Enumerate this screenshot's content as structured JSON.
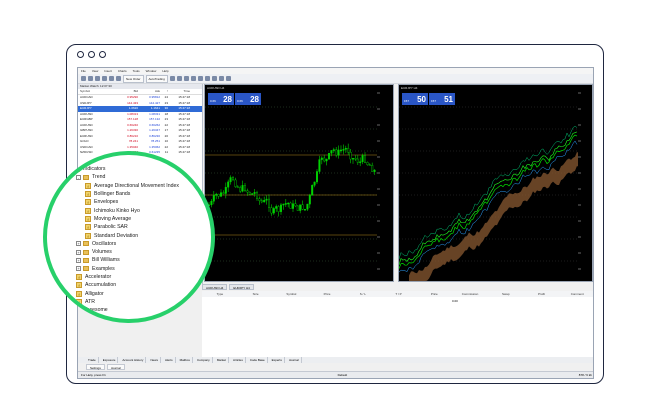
{
  "menu": [
    "File",
    "View",
    "Insert",
    "Charts",
    "Tools",
    "Window",
    "Help"
  ],
  "toolbar": {
    "new_order": "New Order",
    "autotrading": "AutoTrading"
  },
  "market_watch": {
    "title": "Market Watch: 12:07:30",
    "columns": [
      "Symbol",
      "Bid",
      "Ask",
      "!",
      "Time"
    ],
    "rows": [
      {
        "symbol": "AUDCAD",
        "bid": "0.95290",
        "ask": "0.95812",
        "spread": "24",
        "time": "15:47:18"
      },
      {
        "symbol": "USDJPY",
        "bid": "144.433",
        "ask": "144.427",
        "spread": "23",
        "time": "15:47:18"
      },
      {
        "symbol": "EURJPY",
        "bid": "1.0620",
        "ask": "1.1641",
        "spread": "30",
        "time": "15:47:18"
      },
      {
        "symbol": "AUDUSD",
        "bid": "1.08313",
        "ask": "1.08331",
        "spread": "18",
        "time": "15:47:18"
      },
      {
        "symbol": "EURGBP",
        "bid": "157.128",
        "ask": "157.132",
        "spread": "23",
        "time": "15:47:18"
      },
      {
        "symbol": "AUDUSD",
        "bid": "0.66240",
        "ask": "0.66262",
        "spread": "22",
        "time": "15:47:18"
      },
      {
        "symbol": "GBPUSD",
        "bid": "1.26330",
        "ask": "1.26347",
        "spread": "17",
        "time": "15:47:18"
      },
      {
        "symbol": "EURUSD",
        "bid": "0.86210",
        "ask": "0.86230",
        "spread": "20",
        "time": "15:47:18"
      },
      {
        "symbol": "GOLD",
        "bid": "78.241",
        "ask": "78.251",
        "spread": "10",
        "time": "15:47:18"
      },
      {
        "symbol": "USDCAD",
        "bid": "1.35040",
        "ask": "1.35062",
        "spread": "22",
        "time": "15:47:18"
      },
      {
        "symbol": "NZDUSD",
        "bid": "0.61224",
        "ask": "0.61235",
        "spread": "11",
        "time": "15:47:18"
      }
    ]
  },
  "chart_left": {
    "title": "AUDUSD H4",
    "sell_label": "SELL",
    "sell_price": "0.66",
    "sell_big": "28",
    "sell_sup": "4",
    "buy_label": "BUY",
    "buy_price": "0.66",
    "buy_big": "28",
    "buy_sup": "8",
    "bull_color": "#00d200",
    "bear_color": "#00d200",
    "bg": "#000000",
    "x_labels": [
      "9 Nov 2022",
      "22 Nov 2022",
      "5 Dec 2022",
      "18 Dec 2022",
      "1 Jan 2023",
      "12 Jan 2023",
      "25 Jan 2023",
      "7 Feb 2023",
      "20 Feb 2023",
      "5 Mar 2023"
    ]
  },
  "chart_right": {
    "title": "EURJPY H4",
    "sell_label": "SELL",
    "sell_price": "157",
    "sell_big": "50",
    "sell_sup": "0",
    "buy_label": "BUY",
    "buy_price": "157",
    "buy_big": "51",
    "buy_sup": "3",
    "x_labels": [
      "1 Jun 2023",
      "8 Jun 2023",
      "14 Jun 2023",
      "20 Jun 2023",
      "26 Jun 2023",
      "2 Jul 2023"
    ]
  },
  "chart_tabs": [
    "AUDUSD H4",
    "EURJPY H4"
  ],
  "terminal": {
    "columns": [
      "Type",
      "Size",
      "Symbol",
      "Price",
      "S / L",
      "T / P",
      "Price",
      "Commission",
      "Swap",
      "Profit",
      "Comment"
    ],
    "profit": "0.00"
  },
  "bottom_tabs": [
    "Trade",
    "Exposure",
    "Account History",
    "News",
    "Alerts",
    "Mailbox",
    "Company",
    "Market",
    "Articles",
    "Code Base",
    "Experts",
    "Journal"
  ],
  "sub_tabs": [
    "Settings",
    "Journal"
  ],
  "status": {
    "left": "For Help, press F1",
    "middle": "Default",
    "right": "878 / 6 kb"
  },
  "navigator": {
    "items": [
      {
        "label": "Indicators",
        "indent": 0,
        "kind": "folder",
        "pm": "-"
      },
      {
        "label": "Trend",
        "indent": 1,
        "kind": "folder",
        "pm": "-"
      },
      {
        "label": "Average Directional Movement Index",
        "indent": 2,
        "kind": "indicator"
      },
      {
        "label": "Bollinger Bands",
        "indent": 2,
        "kind": "indicator"
      },
      {
        "label": "Envelopes",
        "indent": 2,
        "kind": "indicator"
      },
      {
        "label": "Ichimoku Kinko Hyo",
        "indent": 2,
        "kind": "indicator"
      },
      {
        "label": "Moving Average",
        "indent": 2,
        "kind": "indicator"
      },
      {
        "label": "Parabolic SAR",
        "indent": 2,
        "kind": "indicator"
      },
      {
        "label": "Standard Deviation",
        "indent": 2,
        "kind": "indicator"
      },
      {
        "label": "Oscillators",
        "indent": 1,
        "kind": "folder",
        "pm": "+"
      },
      {
        "label": "Volumes",
        "indent": 1,
        "kind": "folder",
        "pm": "+"
      },
      {
        "label": "Bill Williams",
        "indent": 1,
        "kind": "folder",
        "pm": "+"
      },
      {
        "label": "Examples",
        "indent": 1,
        "kind": "folder",
        "pm": "+"
      },
      {
        "label": "Accelerator",
        "indent": 1,
        "kind": "indicator"
      },
      {
        "label": "Accumulation",
        "indent": 1,
        "kind": "indicator"
      },
      {
        "label": "Alligator",
        "indent": 1,
        "kind": "indicator"
      },
      {
        "label": "ATR",
        "indent": 1,
        "kind": "indicator"
      },
      {
        "label": "Awesome",
        "indent": 1,
        "kind": "indicator"
      }
    ]
  },
  "highlight_color": "#27d06a"
}
